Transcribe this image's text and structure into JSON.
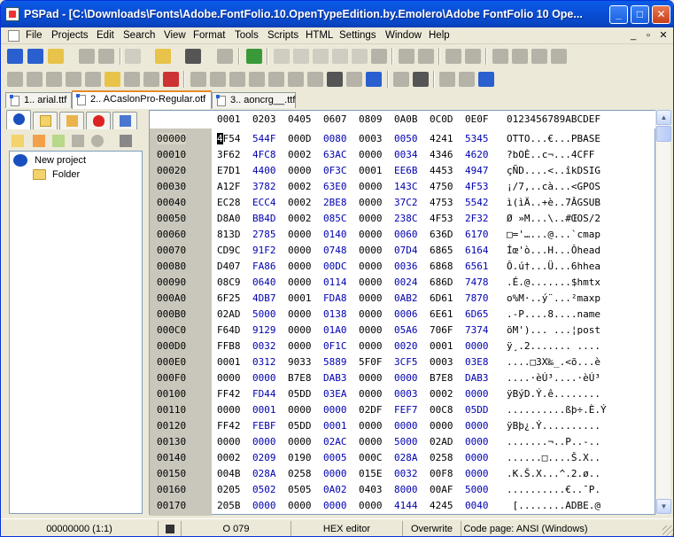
{
  "window": {
    "title": "PSPad - [C:\\Downloads\\Fonts\\Adobe.FontFolio.10.OpenTypeEdition.by.Emolero\\Adobe FontFolio 10 Ope...",
    "minimize": "_",
    "maximize": "□",
    "close": "✕"
  },
  "menu": [
    "File",
    "Projects",
    "Edit",
    "Search",
    "View",
    "Format",
    "Tools",
    "Scripts",
    "HTML",
    "Settings",
    "Window",
    "Help"
  ],
  "menu_right": [
    "_",
    "▫",
    "✕"
  ],
  "tabs": [
    {
      "label": "1.. arial.ttf"
    },
    {
      "label": "2.. ACaslonPro-Regular.otf"
    },
    {
      "label": "3.. aoncrg__.ttf"
    }
  ],
  "project": {
    "root": "New project",
    "child": "Folder"
  },
  "hex": {
    "header_cols": [
      "0001",
      "0203",
      "0405",
      "0607",
      "0809",
      "0A0B",
      "0C0D",
      "0E0F"
    ],
    "header_ascii": "0123456789ABCDEF",
    "rows": [
      {
        "off": "00000",
        "b": [
          "4F54",
          "544F",
          "000D",
          "0080",
          "0003",
          "0050",
          "4241",
          "5345"
        ],
        "a": "OTTO...€...PBASE"
      },
      {
        "off": "00010",
        "b": [
          "3F62",
          "4FC8",
          "0002",
          "63AC",
          "0000",
          "0034",
          "4346",
          "4620"
        ],
        "a": "?bOÈ..c¬...4CFF "
      },
      {
        "off": "00020",
        "b": [
          "E7D1",
          "4400",
          "0000",
          "0F3C",
          "0001",
          "EE6B",
          "4453",
          "4947"
        ],
        "a": "çÑD....<..îkDSIG"
      },
      {
        "off": "00030",
        "b": [
          "A12F",
          "3782",
          "0002",
          "63E0",
          "0000",
          "143C",
          "4750",
          "4F53"
        ],
        "a": "¡/7‚..cà...<GPOS"
      },
      {
        "off": "00040",
        "b": [
          "EC28",
          "ECC4",
          "0002",
          "2BE8",
          "0000",
          "37C2",
          "4753",
          "5542"
        ],
        "a": "ì(ìÄ..+è..7ÂGSUB"
      },
      {
        "off": "00050",
        "b": [
          "D8A0",
          "BB4D",
          "0002",
          "085C",
          "0000",
          "238C",
          "4F53",
          "2F32"
        ],
        "a": "Ø »M...\\..#ŒOS/2"
      },
      {
        "off": "00060",
        "b": [
          "813D",
          "2785",
          "0000",
          "0140",
          "0000",
          "0060",
          "636D",
          "6170"
        ],
        "a": "□='…...@...`cmap"
      },
      {
        "off": "00070",
        "b": [
          "CD9C",
          "91F2",
          "0000",
          "0748",
          "0000",
          "07D4",
          "6865",
          "6164"
        ],
        "a": "Íœ'ò...H...Ôhead"
      },
      {
        "off": "00080",
        "b": [
          "D407",
          "FA86",
          "0000",
          "00DC",
          "0000",
          "0036",
          "6868",
          "6561"
        ],
        "a": "Ô.ú†...Ü...6hhea"
      },
      {
        "off": "00090",
        "b": [
          "08C9",
          "0640",
          "0000",
          "0114",
          "0000",
          "0024",
          "686D",
          "7478"
        ],
        "a": ".É.@.......$hmtx"
      },
      {
        "off": "000A0",
        "b": [
          "6F25",
          "4DB7",
          "0001",
          "FDA8",
          "0000",
          "0AB2",
          "6D61",
          "7870"
        ],
        "a": "o%M·..ý¨...²maxp"
      },
      {
        "off": "000B0",
        "b": [
          "02AD",
          "5000",
          "0000",
          "0138",
          "0000",
          "0006",
          "6E61",
          "6D65"
        ],
        "a": ".-P....8....name"
      },
      {
        "off": "000C0",
        "b": [
          "F64D",
          "9129",
          "0000",
          "01A0",
          "0000",
          "05A6",
          "706F",
          "7374"
        ],
        "a": "öM')... ...¦post"
      },
      {
        "off": "000D0",
        "b": [
          "FFB8",
          "0032",
          "0000",
          "0F1C",
          "0000",
          "0020",
          "0001",
          "0000"
        ],
        "a": "ÿ¸.2....... ...."
      },
      {
        "off": "000E0",
        "b": [
          "0001",
          "0312",
          "9033",
          "5889",
          "5F0F",
          "3CF5",
          "0003",
          "03E8"
        ],
        "a": "....□3X‰_.<õ...è"
      },
      {
        "off": "000F0",
        "b": [
          "0000",
          "0000",
          "B7E8",
          "DAB3",
          "0000",
          "0000",
          "B7E8",
          "DAB3"
        ],
        "a": "....·èÚ³....·èÚ³"
      },
      {
        "off": "00100",
        "b": [
          "FF42",
          "FD44",
          "05DD",
          "03EA",
          "0000",
          "0003",
          "0002",
          "0000"
        ],
        "a": "ÿBýD.Ý.ê........"
      },
      {
        "off": "00110",
        "b": [
          "0000",
          "0001",
          "0000",
          "0000",
          "02DF",
          "FEF7",
          "00C8",
          "05DD"
        ],
        "a": "..........ßþ÷.È.Ý"
      },
      {
        "off": "00120",
        "b": [
          "FF42",
          "FEBF",
          "05DD",
          "0001",
          "0000",
          "0000",
          "0000",
          "0000"
        ],
        "a": "ÿBþ¿.Ý.........."
      },
      {
        "off": "00130",
        "b": [
          "0000",
          "0000",
          "0000",
          "02AC",
          "0000",
          "5000",
          "02AD",
          "0000"
        ],
        "a": ".......¬..P..-.."
      },
      {
        "off": "00140",
        "b": [
          "0002",
          "0209",
          "0190",
          "0005",
          "000C",
          "028A",
          "0258",
          "0000"
        ],
        "a": "......□....Š.X.."
      },
      {
        "off": "00150",
        "b": [
          "004B",
          "028A",
          "0258",
          "0000",
          "015E",
          "0032",
          "00F8",
          "0000"
        ],
        "a": ".K.Š.X...^.2.ø.."
      },
      {
        "off": "00160",
        "b": [
          "0205",
          "0502",
          "0505",
          "0A02",
          "0403",
          "8000",
          "00AF",
          "5000"
        ],
        "a": "..........€..¯P."
      },
      {
        "off": "00170",
        "b": [
          "205B",
          "0000",
          "0000",
          "0000",
          "0000",
          "4144",
          "4245",
          "0040"
        ],
        "a": " [........ADBE.@"
      }
    ]
  },
  "status": {
    "position": "00000000  (1:1)",
    "col": "O  079",
    "mode": "HEX editor",
    "overwrite": "Overwrite",
    "codepage": "Code page: ANSI (Windows)"
  },
  "colors": {
    "title": "#0a4fd8",
    "offset_bg": "#c9c7bc",
    "hex_odd": "#0000b0"
  }
}
